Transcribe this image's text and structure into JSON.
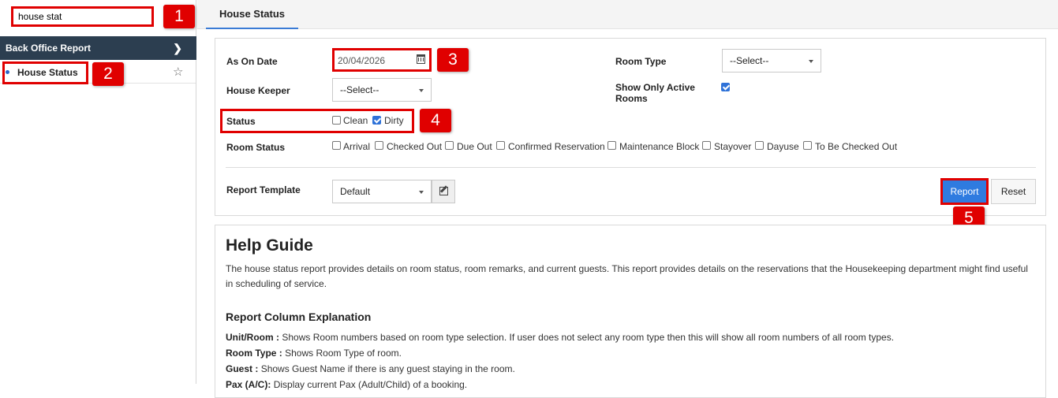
{
  "sidebar": {
    "search_value": "house stat",
    "section_title": "Back Office Report",
    "section_chevron": "chevron-right-icon",
    "items": [
      {
        "label": "House Status",
        "favorite_icon": "star-outline-icon"
      }
    ]
  },
  "tabs": [
    {
      "label": "House Status",
      "active": true
    }
  ],
  "form": {
    "as_on_date_label": "As On Date",
    "as_on_date_value": "20/04/2026",
    "house_keeper_label": "House Keeper",
    "house_keeper_value": "--Select--",
    "room_type_label": "Room Type",
    "room_type_value": "--Select--",
    "show_active_label": "Show Only Active Rooms",
    "show_active_checked": true,
    "status_label": "Status",
    "status_options": [
      {
        "label": "Clean",
        "checked": false
      },
      {
        "label": "Dirty",
        "checked": true
      }
    ],
    "room_status_label": "Room Status",
    "room_status_options": [
      {
        "label": "Arrival",
        "checked": false
      },
      {
        "label": "Checked Out",
        "checked": false
      },
      {
        "label": "Due Out",
        "checked": false
      },
      {
        "label": "Confirmed Reservation",
        "checked": false
      },
      {
        "label": "Maintenance Block",
        "checked": false
      },
      {
        "label": "Stayover",
        "checked": false
      },
      {
        "label": "Dayuse",
        "checked": false
      },
      {
        "label": "To Be Checked Out",
        "checked": false
      }
    ],
    "report_template_label": "Report Template",
    "report_template_value": "Default",
    "report_button": "Report",
    "reset_button": "Reset"
  },
  "callouts": [
    "1",
    "2",
    "3",
    "4",
    "5"
  ],
  "help": {
    "title": "Help Guide",
    "intro": "The house status report provides details on room status, room remarks, and current guests. This report provides details on the reservations that the Housekeeping department might find useful in scheduling of service.",
    "columns_title": "Report Column Explanation",
    "columns": [
      {
        "name": "Unit/Room :",
        "desc": "Shows Room numbers based on room type selection. If user does not select any room type then this will show all room numbers of all room types."
      },
      {
        "name": "Room Type :",
        "desc": "Shows Room Type of room."
      },
      {
        "name": "Guest :",
        "desc": "Shows Guest Name if there is any guest staying in the room."
      },
      {
        "name": "Pax (A/C):",
        "desc": "Display current Pax (Adult/Child) of a booking."
      }
    ]
  },
  "colors": {
    "accent": "#2f7be0",
    "sidebar_header": "#2c3e50",
    "highlight": "#e00000"
  }
}
